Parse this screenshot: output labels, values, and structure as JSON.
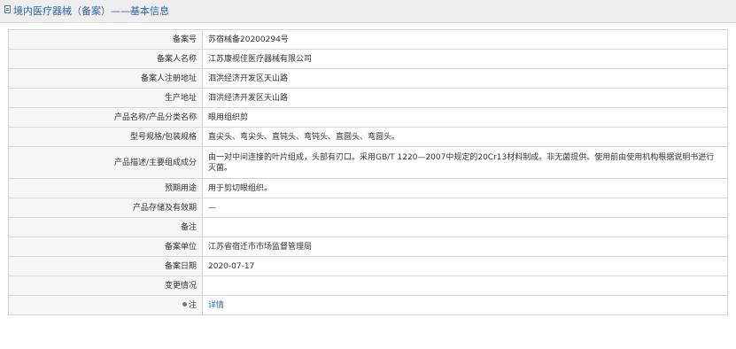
{
  "header": {
    "title": "境内医疗器械（备案）——基本信息"
  },
  "rows": [
    {
      "label": "备案号",
      "value": "苏宿械备20200294号"
    },
    {
      "label": "备案人名称",
      "value": "江苏康视佳医疗器械有限公司"
    },
    {
      "label": "备案人注册地址",
      "value": "泗洪经济开发区天山路"
    },
    {
      "label": "生产地址",
      "value": "泗洪经济开发区天山路"
    },
    {
      "label": "产品名称/产品分类名称",
      "value": "眼用组织剪"
    },
    {
      "label": "型号规格/包装规格",
      "value": "直尖头、弯尖头、直钝头、弯钝头、直圆头、弯圆头。"
    },
    {
      "label": "产品描述/主要组成成分",
      "value": "由一对中间连接的叶片组成，头部有刃口。采用GB/T 1220—2007中规定的20Cr13材料制成。非无菌提供。使用前由使用机构根据说明书进行灭菌。"
    },
    {
      "label": "预期用途",
      "value": "用于剪切眼组织。"
    },
    {
      "label": "产品存储及有效期",
      "value": "—"
    },
    {
      "label": "备注",
      "value": ""
    },
    {
      "label": "备案单位",
      "value": "江苏省宿迁市市场监督管理局"
    },
    {
      "label": "备案日期",
      "value": "2020-07-17"
    },
    {
      "label": "变更情况",
      "value": ""
    },
    {
      "label": "注",
      "value": "详情"
    }
  ],
  "colors": {
    "header_bg": "#eeeeee",
    "title": "#2b66a8",
    "link": "#2b66a8",
    "label_bg": "#f7f7f7",
    "border": "#d7d7d7"
  }
}
